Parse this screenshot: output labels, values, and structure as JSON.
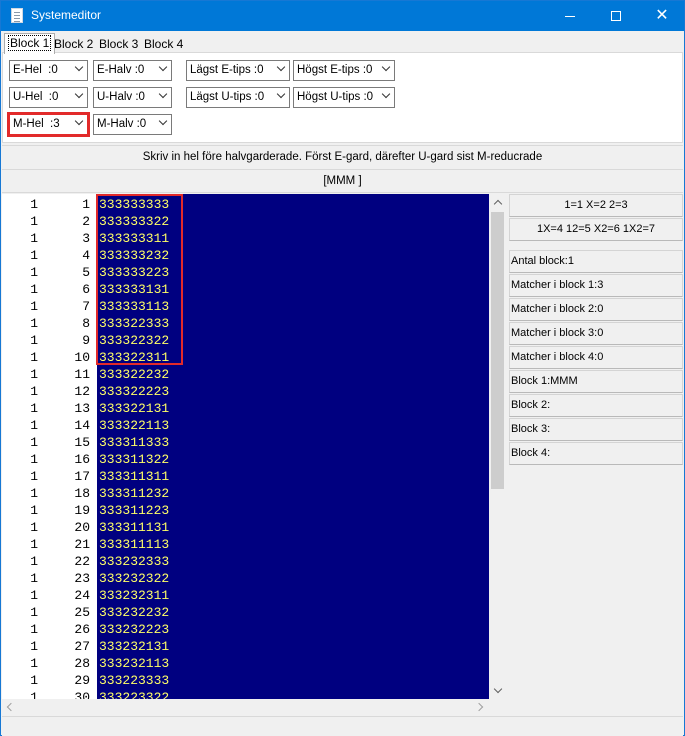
{
  "window": {
    "title": "Systemeditor"
  },
  "tabs": [
    "Block 1",
    "Block 2",
    "Block 3",
    "Block 4"
  ],
  "options": {
    "e_hel": "E-Hel  :0",
    "e_halv": "E-Halv :0",
    "lagst_e": "Lägst E-tips :0",
    "hogst_e": "Högst E-tips :0",
    "u_hel": "U-Hel  :0",
    "u_halv": "U-Halv :0",
    "lagst_u": "Lägst U-tips :0",
    "hogst_u": "Högst U-tips :0",
    "m_hel": "M-Hel  :3",
    "m_halv": "M-Halv :0"
  },
  "info_text": "Skriv in hel före halvgarderade. Först E-gard, därefter U-gard sist M-reducrade",
  "block_text": "[MMM   ]",
  "rows": [
    {
      "a": "1",
      "n": "1",
      "code": "333333333"
    },
    {
      "a": "1",
      "n": "2",
      "code": "333333322"
    },
    {
      "a": "1",
      "n": "3",
      "code": "333333311"
    },
    {
      "a": "1",
      "n": "4",
      "code": "333333232"
    },
    {
      "a": "1",
      "n": "5",
      "code": "333333223"
    },
    {
      "a": "1",
      "n": "6",
      "code": "333333131"
    },
    {
      "a": "1",
      "n": "7",
      "code": "333333113"
    },
    {
      "a": "1",
      "n": "8",
      "code": "333322333"
    },
    {
      "a": "1",
      "n": "9",
      "code": "333322322"
    },
    {
      "a": "1",
      "n": "10",
      "code": "333322311"
    },
    {
      "a": "1",
      "n": "11",
      "code": "333322232"
    },
    {
      "a": "1",
      "n": "12",
      "code": "333322223"
    },
    {
      "a": "1",
      "n": "13",
      "code": "333322131"
    },
    {
      "a": "1",
      "n": "14",
      "code": "333322113"
    },
    {
      "a": "1",
      "n": "15",
      "code": "333311333"
    },
    {
      "a": "1",
      "n": "16",
      "code": "333311322"
    },
    {
      "a": "1",
      "n": "17",
      "code": "333311311"
    },
    {
      "a": "1",
      "n": "18",
      "code": "333311232"
    },
    {
      "a": "1",
      "n": "19",
      "code": "333311223"
    },
    {
      "a": "1",
      "n": "20",
      "code": "333311131"
    },
    {
      "a": "1",
      "n": "21",
      "code": "333311113"
    },
    {
      "a": "1",
      "n": "22",
      "code": "333232333"
    },
    {
      "a": "1",
      "n": "23",
      "code": "333232322"
    },
    {
      "a": "1",
      "n": "24",
      "code": "333232311"
    },
    {
      "a": "1",
      "n": "25",
      "code": "333232232"
    },
    {
      "a": "1",
      "n": "26",
      "code": "333232223"
    },
    {
      "a": "1",
      "n": "27",
      "code": "333232131"
    },
    {
      "a": "1",
      "n": "28",
      "code": "333232113"
    },
    {
      "a": "1",
      "n": "29",
      "code": "333223333"
    },
    {
      "a": "1",
      "n": "30",
      "code": "333223322"
    }
  ],
  "right_panel": {
    "legend1": "1=1  X=2  2=3",
    "legend2": "1X=4  12=5  X2=6  1X2=7",
    "antal": "Antal block:1",
    "m1": "Matcher i block 1:3",
    "m2": "Matcher i block 2:0",
    "m3": "Matcher i block 3:0",
    "m4": "Matcher i block 4:0",
    "b1": "Block 1:MMM",
    "b2": "Block 2:",
    "b3": "Block 3:",
    "b4": "Block 4:"
  }
}
